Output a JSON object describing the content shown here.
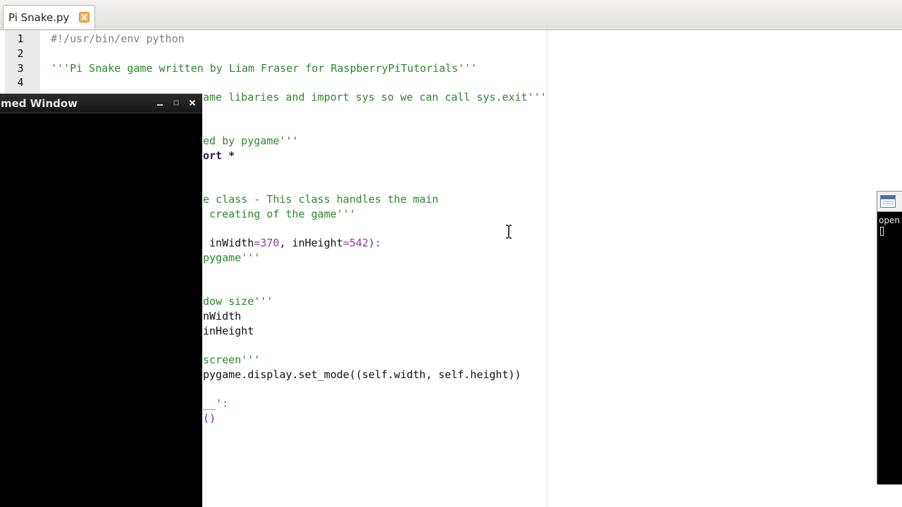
{
  "tab": {
    "label": "Pi Snake.py",
    "close_icon": "close-icon"
  },
  "line_numbers": [
    "1",
    "2",
    "3",
    "4"
  ],
  "code": {
    "line1": "#!/usr/bin/env python",
    "line3": "'''Pi Snake game written by Liam Fraser for RaspberryPiTutorials'''",
    "line5_tail": "ame libaries and import sys so we can call sys.exit'''",
    "line8_tail": "ed by pygame'''",
    "line9_tail": "ort",
    "line9_star": "*",
    "line12_tail": "e class - This class handles the main",
    "line13_tail": " creating of the game'''",
    "line15_a": " inWidth",
    "line15_eq1": "=",
    "line15_num1": "370",
    "line15_sep": ", inHeight",
    "line15_eq2": "=",
    "line15_num2": "542",
    "line15_end": "):",
    "line16_tail": "pygame'''",
    "line19_tail": "dow size'''",
    "line20_tail": "nWidth",
    "line21_tail": "inHeight",
    "line23_tail": "screen'''",
    "line24_tail": "pygame.display.set_mode((self.width, self.height))",
    "line26_tail": "__':",
    "line27_tail": "()"
  },
  "overlay_window": {
    "title": "med Window",
    "minimize_icon": "minimize-icon",
    "maximize_icon": "maximize-icon",
    "close_icon": "close-icon"
  },
  "right_window": {
    "text": "open",
    "icon": "window-icon"
  },
  "colors": {
    "comment": "#7e7e7e",
    "string": "#2b8a2b",
    "keyword": "#2a1560",
    "number": "#8a3ab3",
    "tab_close": "#f2a13b"
  }
}
